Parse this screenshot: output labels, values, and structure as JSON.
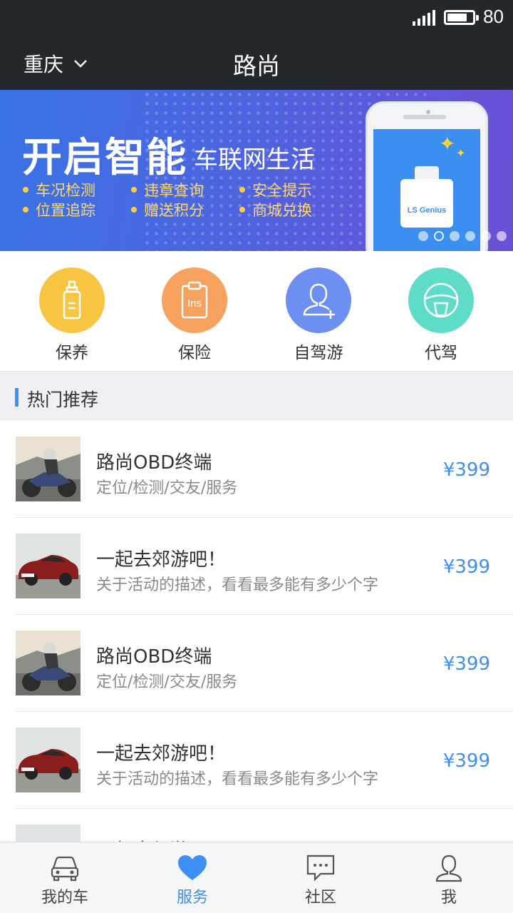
{
  "status_bar": {
    "battery_text": "80",
    "battery_level": 0.8
  },
  "nav": {
    "city": "重庆",
    "title": "路尚"
  },
  "banner": {
    "title": "开启智能",
    "subtitle": "车联网生活",
    "features": [
      "车况检测",
      "违章查询",
      "安全提示",
      "位置追踪",
      "赠送积分",
      "商城兑换"
    ],
    "device_label": "LS Genius",
    "page_count": 6,
    "active_page": 2
  },
  "categories": [
    {
      "label": "保养",
      "icon": "lotion-bottle-icon",
      "color": "#f7c542"
    },
    {
      "label": "保险",
      "icon": "insurance-clipboard-icon",
      "color": "#f6a25e"
    },
    {
      "label": "自驾游",
      "icon": "add-person-icon",
      "color": "#6e8ff2"
    },
    {
      "label": "代驾",
      "icon": "steering-wheel-icon",
      "color": "#5fdcc8"
    }
  ],
  "section": {
    "title": "热门推荐"
  },
  "list": [
    {
      "title": "路尚OBD终端",
      "desc": "定位/检测/交友/服务",
      "price": "¥399",
      "thumb": "motorcycle"
    },
    {
      "title": "一起去郊游吧！",
      "desc": "关于活动的描述，看看最多能有多少个字",
      "price": "¥399",
      "thumb": "car"
    },
    {
      "title": "路尚OBD终端",
      "desc": "定位/检测/交友/服务",
      "price": "¥399",
      "thumb": "motorcycle"
    },
    {
      "title": "一起去郊游吧！",
      "desc": "关于活动的描述，看看最多能有多少个字",
      "price": "¥399",
      "thumb": "car"
    },
    {
      "title": "一起去郊游吧！",
      "desc": "",
      "price": "",
      "thumb": "car"
    }
  ],
  "tabs": [
    {
      "label": "我的车",
      "icon": "car-icon",
      "active": false
    },
    {
      "label": "服务",
      "icon": "heart-icon",
      "active": true
    },
    {
      "label": "社区",
      "icon": "chat-bubble-icon",
      "active": false
    },
    {
      "label": "我",
      "icon": "person-icon",
      "active": false
    }
  ],
  "colors": {
    "accent": "#3b8ff5",
    "dark_bar": "#24272b",
    "section_bg": "#eef0f4"
  }
}
